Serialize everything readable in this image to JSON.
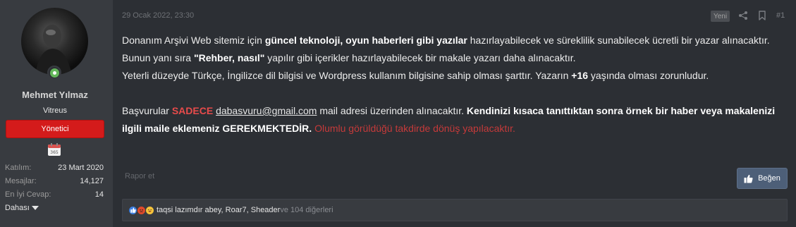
{
  "user": {
    "name": "Mehmet Yılmaz",
    "title": "Vitreus",
    "role": "Yönetici",
    "calendar_day": "365",
    "stats": [
      {
        "label": "Katılım:",
        "value": "23 Mart 2020"
      },
      {
        "label": "Mesajlar:",
        "value": "14,127"
      },
      {
        "label": "En İyi Cevap:",
        "value": "14"
      }
    ],
    "more_label": "Dahası"
  },
  "post": {
    "date": "29 Ocak 2022, 23:30",
    "new_badge": "Yeni",
    "number": "#1",
    "line1_pre": "Donanım Arşivi Web sitemiz için ",
    "line1_bold": "güncel teknoloji, oyun haberleri gibi yazılar",
    "line1_post": " hazırlayabilecek ve süreklilik sunabilecek ücretli bir yazar alınacaktır.",
    "line2_pre": "Bunun yanı sıra ",
    "line2_bold": "\"Rehber, nasıl\"",
    "line2_post": " yapılır gibi içerikler hazırlayabilecek bir makale yazarı daha alınacaktır.",
    "line3_pre": "Yeterli düzeyde Türkçe, İngilizce dil bilgisi ve Wordpress kullanım bilgisine sahip olması şarttır. Yazarın ",
    "line3_bold": "+16",
    "line3_post": " yaşında olması zorunludur.",
    "line4_pre": "Başvurular ",
    "line4_red": "SADECE",
    "line4_email": "dabasvuru@gmail.com",
    "line4_mid": " mail adresi üzerinden alınacaktır. ",
    "line4_bold": "Kendinizi kısaca tanıttıktan sonra örnek bir haber veya makalenizi ilgili maile eklemeniz GEREKMEKTEDİR.",
    "line4_red2": " Olumlu görüldüğü takdirde dönüş yapılacaktır."
  },
  "actions": {
    "report_label": "Rapor et",
    "like_label": "Beğen"
  },
  "reactions": {
    "users": [
      "taqsi lazımdır abey",
      "Roar7",
      "Sheader"
    ],
    "others": " ve 104 diğerleri"
  }
}
